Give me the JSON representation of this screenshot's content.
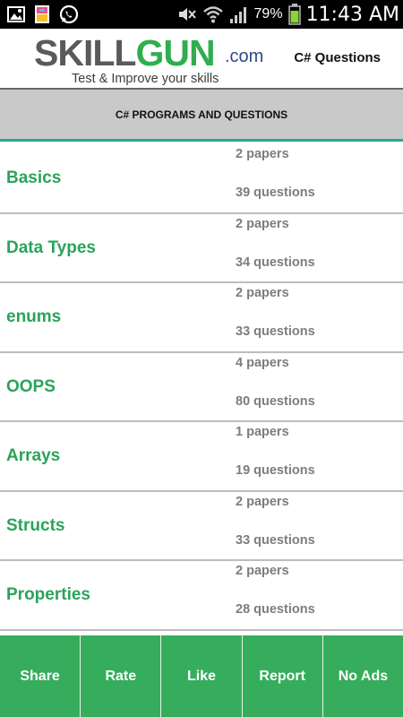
{
  "status_bar": {
    "battery_percent": "79%",
    "time": "11:43 AM",
    "left_icons": [
      "image-icon",
      "gallery-notification-icon",
      "whatsapp-icon"
    ],
    "right_icons": [
      "mute-icon",
      "wifi-icon",
      "signal-icon",
      "battery-icon"
    ]
  },
  "header": {
    "logo_skill": "SKILL",
    "logo_gun": "GUN",
    "logo_domain": ".com",
    "tagline": "Test & Improve your skills",
    "title": "C# Questions"
  },
  "section": {
    "title": "C# PROGRAMS AND QUESTIONS"
  },
  "topics": [
    {
      "name": "Basics",
      "papers": "2 papers",
      "questions": "39 questions"
    },
    {
      "name": "Data Types",
      "papers": "2 papers",
      "questions": "34 questions"
    },
    {
      "name": "enums",
      "papers": "2 papers",
      "questions": "33 questions"
    },
    {
      "name": "OOPS",
      "papers": "4 papers",
      "questions": "80 questions"
    },
    {
      "name": "Arrays",
      "papers": "1 papers",
      "questions": "19 questions"
    },
    {
      "name": "Structs",
      "papers": "2 papers",
      "questions": "33 questions"
    },
    {
      "name": "Properties",
      "papers": "2 papers",
      "questions": "28 questions"
    }
  ],
  "bottom_bar": {
    "share": "Share",
    "rate": "Rate",
    "like": "Like",
    "report": "Report",
    "no_ads": "No Ads"
  },
  "colors": {
    "accent_green": "#2aa35b",
    "bottom_bar": "#35ad5c",
    "section_bar": "#c9c9c9",
    "teal_rule": "#29a597"
  }
}
